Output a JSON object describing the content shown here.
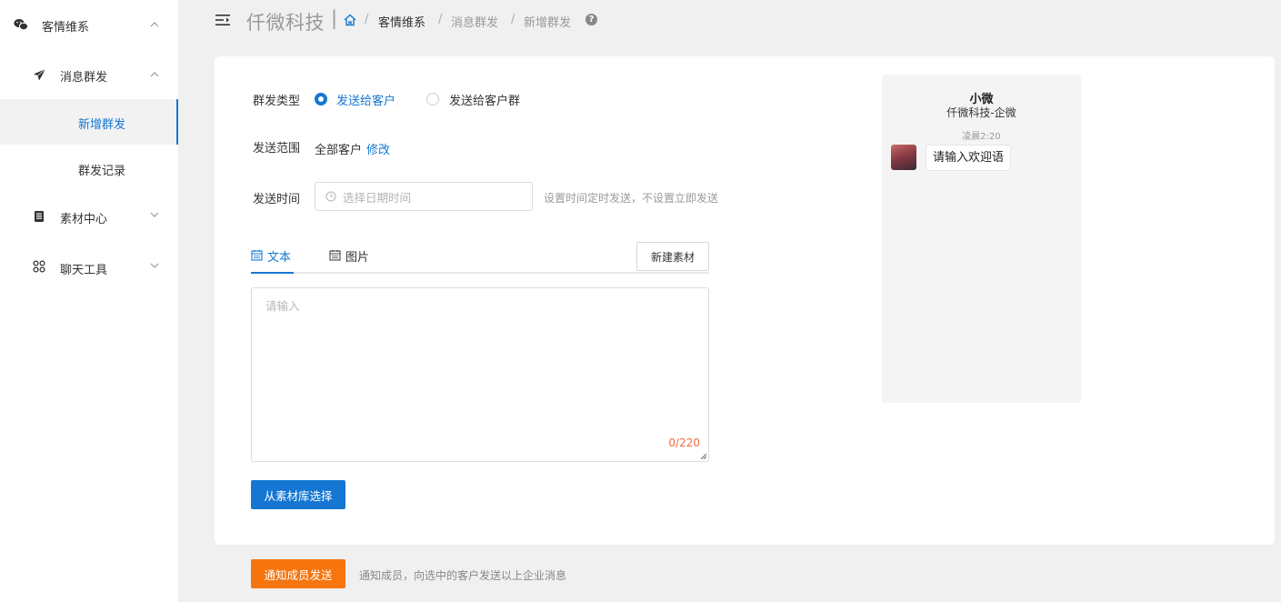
{
  "sidebar": {
    "groups": [
      {
        "label": "客情维系",
        "icon": "wechat-icon",
        "expanded": true
      },
      {
        "label": "消息群发",
        "icon": "send-icon",
        "expanded": true
      },
      {
        "label": "素材中心",
        "icon": "material-icon",
        "expanded": false
      },
      {
        "label": "聊天工具",
        "icon": "grid-icon",
        "expanded": false
      }
    ],
    "items": [
      {
        "label": "新增群发",
        "active": true
      },
      {
        "label": "群发记录",
        "active": false
      }
    ]
  },
  "header": {
    "brand": "仟微科技",
    "separator": "|",
    "breadcrumb": [
      "客情维系",
      "消息群发",
      "新增群发"
    ],
    "breadcrumb_sep": "/"
  },
  "form": {
    "type_label": "群发类型",
    "type_options": [
      {
        "label": "发送给客户",
        "selected": true
      },
      {
        "label": "发送给客户群",
        "selected": false
      }
    ],
    "scope_label": "发送范围",
    "scope_value": "全部客户",
    "scope_edit": "修改",
    "time_label": "发送时间",
    "time_placeholder": "选择日期时间",
    "time_hint": "设置时间定时发送，不设置立即发送",
    "tabs": [
      {
        "label": "文本",
        "active": true
      },
      {
        "label": "图片",
        "active": false
      }
    ],
    "new_material": "新建素材",
    "content_placeholder": "请输入",
    "counter": "0/220",
    "pick_material": "从素材库选择"
  },
  "preview": {
    "name": "小微",
    "corp": "仟微科技-企微",
    "time": "凌晨2:20",
    "message": "请输入欢迎语"
  },
  "footer": {
    "notify_button": "通知成员发送",
    "notify_hint": "通知成员，向选中的客户发送以上企业消息"
  },
  "colors": {
    "accent": "#1677d2",
    "orange": "#f6750f",
    "counter": "#ef6c3b",
    "background": "#f0f0f0"
  }
}
